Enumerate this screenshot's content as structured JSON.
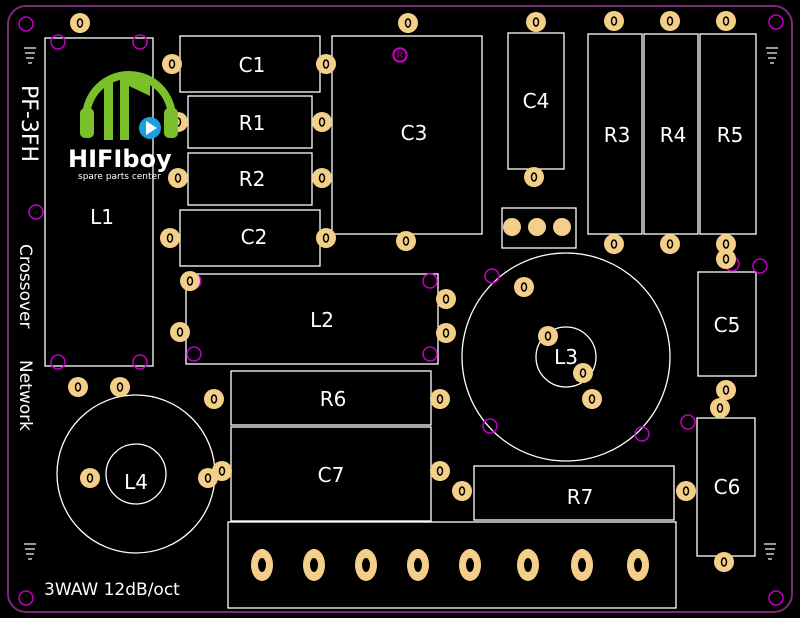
{
  "board": {
    "model": "PF-3FH",
    "description_line1": "Crossover",
    "description_line2": "Network",
    "spec": "3WAW 12dB/oct",
    "marker": "R",
    "colors": {
      "background": "#000000",
      "outline": "#7a2a7a",
      "silk": "#ffffff",
      "pad": "#f3cf8a",
      "via": "#c000c0"
    }
  },
  "logo": {
    "brand": "HIFIboy",
    "tagline": "spare parts center",
    "icon": "headphone-music-logo",
    "colors": {
      "green": "#7ac02a",
      "blue": "#1aa0e0"
    }
  },
  "components": {
    "C1": "C1",
    "C2": "C2",
    "C3": "C3",
    "C4": "C4",
    "C5": "C5",
    "C6": "C6",
    "C7": "C7",
    "R1": "R1",
    "R2": "R2",
    "R3": "R3",
    "R4": "R4",
    "R5": "R5",
    "R6": "R6",
    "R7": "R7",
    "L1": "L1",
    "L2": "L2",
    "L3": "L3",
    "L4": "L4"
  }
}
